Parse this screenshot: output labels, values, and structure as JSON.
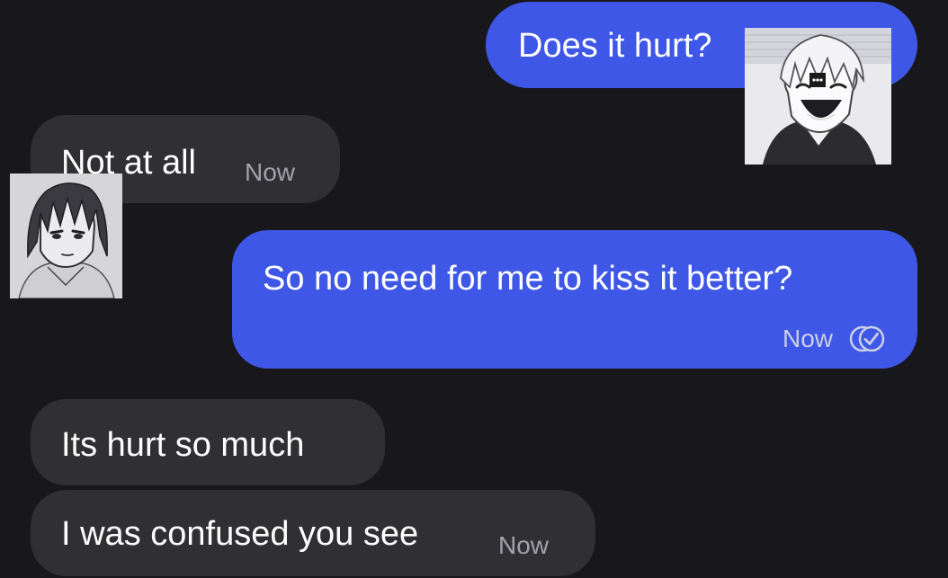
{
  "messages": [
    {
      "direction": "outgoing",
      "text": "Does it hurt?",
      "time": ""
    },
    {
      "direction": "incoming",
      "text": "Not at all",
      "time": "Now"
    },
    {
      "direction": "outgoing",
      "text": "So no need for me to kiss it better?",
      "time": "Now",
      "status_icon": "read-check-icon"
    },
    {
      "direction": "incoming",
      "text": "Its hurt so much",
      "time": ""
    },
    {
      "direction": "incoming",
      "text": "I was confused you see",
      "time": "Now"
    }
  ],
  "colors": {
    "background": "#18181c",
    "outgoing_bubble": "#3e57e6",
    "incoming_bubble": "#2f2f34"
  },
  "avatars": {
    "sender": "manga-character-laughing-avatar",
    "contact": "manga-character-dark-hair-avatar"
  }
}
